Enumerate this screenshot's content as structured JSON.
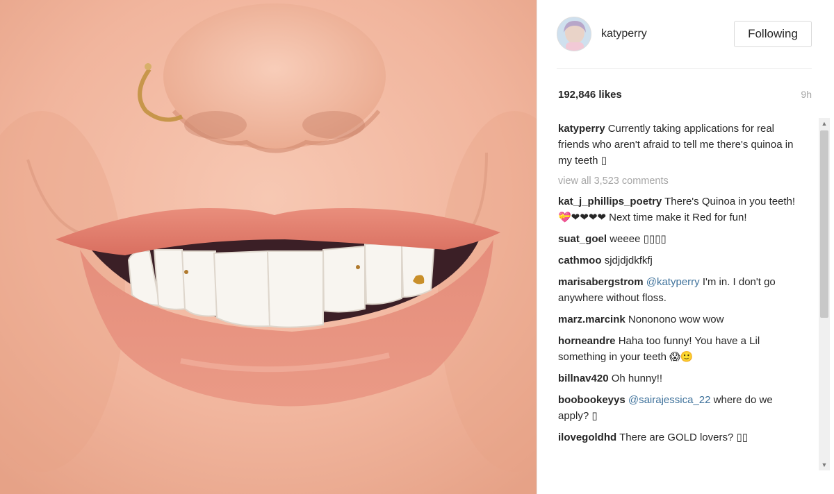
{
  "post": {
    "username": "katyperry",
    "follow_label": "Following",
    "likes": "192,846 likes",
    "time": "9h",
    "caption_user": "katyperry",
    "caption_text": "Currently taking applications for real friends who aren't afraid to tell me there's quinoa in my teeth ▯",
    "view_all": "view all 3,523 comments"
  },
  "comments": [
    {
      "user": "kat_j_phillips_poetry",
      "mention": "",
      "text": "There's Quinoa in you teeth! 💝❤❤❤❤ Next time make it Red for fun!"
    },
    {
      "user": "suat_goel",
      "mention": "",
      "text": "weeee ▯▯▯▯"
    },
    {
      "user": "cathmoo",
      "mention": "",
      "text": "sjdjdjdkfkfj"
    },
    {
      "user": "marisabergstrom",
      "mention": "@katyperry",
      "text": "I'm in. I don't go anywhere without floss."
    },
    {
      "user": "marz.marcink",
      "mention": "",
      "text": "Nononono wow wow"
    },
    {
      "user": "horneandre",
      "mention": "",
      "text": "Haha too funny! You have a Lil something in your teeth 😱🙂"
    },
    {
      "user": "billnav420",
      "mention": "",
      "text": "Oh hunny!!"
    },
    {
      "user": "boobookeyys",
      "mention": "@sairajessica_22",
      "text": "where do we apply? ▯"
    },
    {
      "user": "ilovegoldhd",
      "mention": "",
      "text": "There are GOLD lovers? ▯▯"
    }
  ],
  "icons": {
    "scroll_up": "chevron-up-icon",
    "scroll_down": "chevron-down-icon"
  },
  "colors": {
    "mention": "#3f729b",
    "muted": "#a5a5a5",
    "lips": "#e0897a"
  }
}
